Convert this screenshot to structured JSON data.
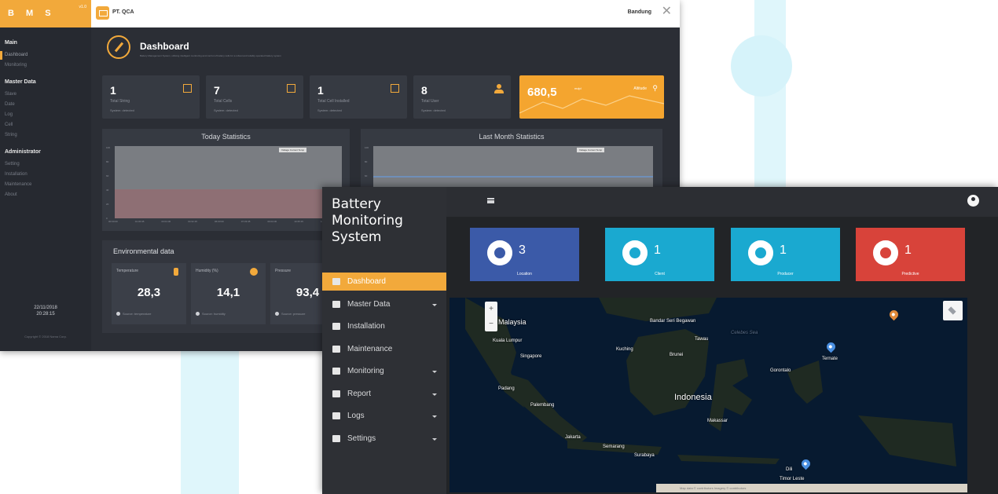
{
  "colors": {
    "accent": "#f2a93b",
    "card_location": "#3b5aa8",
    "card_client": "#1aa9d0",
    "card_producer": "#1aa9d0",
    "card_predictive": "#d8433a",
    "pin_orange": "#e08a3a",
    "pin_blue": "#4a90e2"
  },
  "shot_a": {
    "brand": "B M S",
    "version": "v1.0",
    "company": "PT. QCA",
    "city": "Bandung",
    "sidebar": [
      {
        "section": "Main",
        "items": [
          "Dashboard",
          "Monitoring"
        ]
      },
      {
        "section": "Master Data",
        "items": [
          "Slave",
          "Date",
          "Log",
          "Cell",
          "String"
        ]
      },
      {
        "section": "Administrator",
        "items": [
          "Setting",
          "Installation",
          "Maintenance",
          "About"
        ]
      }
    ],
    "date": "22/11/2018",
    "time": "20:28:15",
    "copyright": "Copyright © 2018 Nama Corp.",
    "dashboard_title": "Dashboard",
    "dashboard_subtitle": "Battery Management System, utilising intelligent monitoring and control of battery cells for a robust and reliably operated battery system",
    "stats": [
      {
        "value": "1",
        "label": "Total String",
        "updated": "System: detected"
      },
      {
        "value": "7",
        "label": "Total Cells",
        "updated": "System: detected"
      },
      {
        "value": "1",
        "label": "Total Cell Installed",
        "updated": "System: detected"
      },
      {
        "value": "8",
        "label": "Total User",
        "updated": "System: detected"
      }
    ],
    "altitude": {
      "value": "680,5",
      "unit": "mdpl",
      "label": "Altitude"
    },
    "today_title": "Today Statistics",
    "lastmonth_title": "Last Month Statistics",
    "chart_legend": [
      "Voltage",
      "Current",
      "Temp"
    ],
    "today_xticks": [
      "00:00:00",
      "01:30:45",
      "03:01:30",
      "04:32:15",
      "06:03:00",
      "07:33:45",
      "09:04:30",
      "10:35:15",
      "12:06:00"
    ],
    "y_ticks": [
      "100",
      "80",
      "60",
      "40",
      "20",
      "0"
    ],
    "env_title": "Environmental data",
    "env": [
      {
        "label": "Temperature",
        "value": "28,3",
        "updated": "Source: temperature"
      },
      {
        "label": "Humidity (%)",
        "value": "14,1",
        "updated": "Source: humidity"
      },
      {
        "label": "Pressure",
        "value": "93,4",
        "updated": "Source: pressure"
      }
    ]
  },
  "shot_b": {
    "title_line1": "Battery",
    "title_line2": "Monitoring",
    "title_line3": "System",
    "menu": [
      {
        "label": "Dashboard",
        "active": true,
        "has_caret": false,
        "icon": "dashboard-icon"
      },
      {
        "label": "Master Data",
        "active": false,
        "has_caret": true,
        "icon": "folder-icon"
      },
      {
        "label": "Installation",
        "active": false,
        "has_caret": false,
        "icon": "wrench-icon"
      },
      {
        "label": "Maintenance",
        "active": false,
        "has_caret": false,
        "icon": "toolbox-icon"
      },
      {
        "label": "Monitoring",
        "active": false,
        "has_caret": true,
        "icon": "line-chart-icon"
      },
      {
        "label": "Report",
        "active": false,
        "has_caret": true,
        "icon": "file-icon"
      },
      {
        "label": "Logs",
        "active": false,
        "has_caret": true,
        "icon": "table-icon"
      },
      {
        "label": "Settings",
        "active": false,
        "has_caret": true,
        "icon": "cogs-icon"
      }
    ],
    "cards": [
      {
        "value": "3",
        "label": "Location",
        "icon": "map-icon"
      },
      {
        "value": "1",
        "label": "Client",
        "icon": "briefcase-icon"
      },
      {
        "value": "1",
        "label": "Producer",
        "icon": "building-icon"
      },
      {
        "value": "1",
        "label": "Predictive",
        "icon": "bar-chart-icon"
      }
    ],
    "map": {
      "labels": [
        "Malaysia",
        "Kuala Lumpur",
        "Singapore",
        "Bandar Seri Begawan",
        "Kuching",
        "Tawau",
        "Brunei",
        "Ternate",
        "Padang",
        "Palembang",
        "Indonesia",
        "Makassar",
        "Jakarta",
        "Semarang",
        "Surabaya",
        "Dili",
        "Celebes Sea",
        "Gorontalo",
        "Timor Leste"
      ],
      "zoom_in": "+",
      "zoom_out": "−",
      "attribution": "Map data ©   contributors   Imagery ©   contributors"
    }
  }
}
